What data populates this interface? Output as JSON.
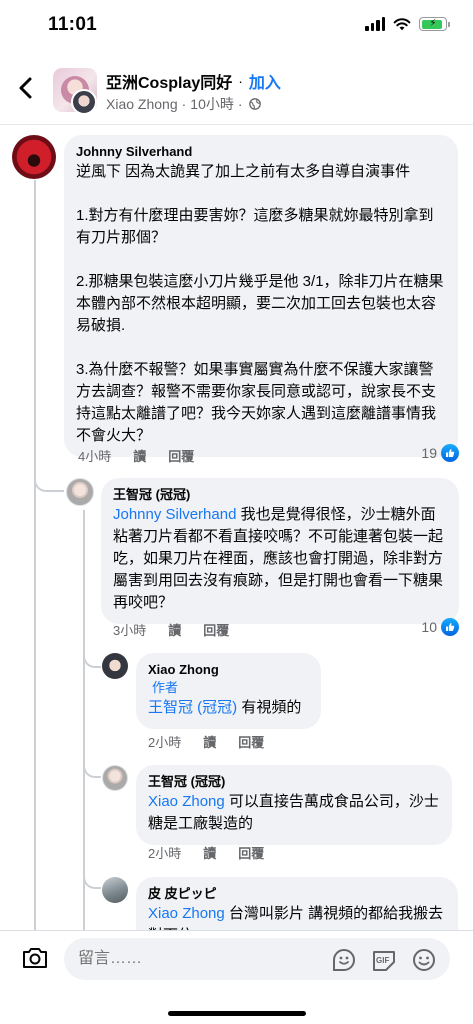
{
  "status_bar": {
    "time": "11:01",
    "battery_level": 0.9
  },
  "header": {
    "group_name": "亞洲Cosplay同好",
    "separator": "·",
    "join_label": "加入",
    "poster": "Xiao Zhong",
    "time_ago": "10小時",
    "dot": "·"
  },
  "comments": [
    {
      "author": "Johnny Silverhand",
      "text": "逆風下 因為太詭異了加上之前有太多自導自演事件\n\n1.對方有什麼理由要害妳？這麼多糖果就妳最特別拿到有刀片那個？\n\n2.那糖果包裝這麼小刀片幾乎是他 3/1，除非刀片在糖果本體內部不然根本超明顯，要二次加工回去包裝也太容易破損.\n\n3.為什麼不報警？如果事實屬實為什麼不保護大家讓警方去調查？報警不需要你家長同意或認可，說家長不支持這點太離譜了吧？我今天妳家人遇到這麼離譜事情我不會火大？",
      "time": "4小時",
      "read": "讀",
      "reply": "回覆",
      "likes": "19"
    },
    {
      "author": "王智冠 (冠冠)",
      "mention": "Johnny Silverhand",
      "text": " 我也是覺得很怪，沙士糖外面粘著刀片看都不看直接咬嗎？不可能連著包裝一起吃，如果刀片在裡面，應該也會打開過，除非對方屬害到用回去沒有痕跡，但是打開也會看一下糖果再咬吧？",
      "time": "3小時",
      "read": "讀",
      "reply": "回覆",
      "likes": "10"
    },
    {
      "author": "Xiao Zhong",
      "badge": "作者",
      "mention": "王智冠 (冠冠)",
      "text": " 有視頻的",
      "time": "2小時",
      "read": "讀",
      "reply": "回覆"
    },
    {
      "author": "王智冠 (冠冠)",
      "mention": "Xiao Zhong",
      "text": " 可以直接告萬成食品公司，沙士糖是工廠製造的",
      "time": "2小時",
      "read": "讀",
      "reply": "回覆"
    },
    {
      "author": "皮 皮ピッピ",
      "mention": "Xiao Zhong",
      "text": " 台灣叫影片 講視頻的都給我搬去對面住"
    }
  ],
  "composer": {
    "placeholder": "留言……",
    "gif_label": "GIF"
  },
  "colors": {
    "link": "#1877f2",
    "bubble": "#f0f2f5",
    "meta": "#65676b"
  }
}
